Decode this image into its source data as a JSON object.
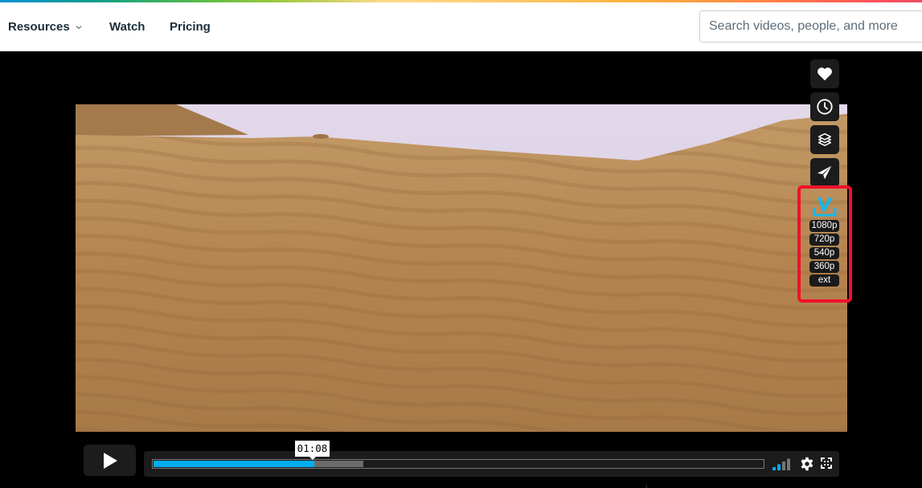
{
  "nav": {
    "items": [
      {
        "label": "Resources",
        "has_dropdown": true
      },
      {
        "label": "Watch"
      },
      {
        "label": "Pricing"
      }
    ],
    "search_placeholder": "Search videos, people, and more"
  },
  "player": {
    "side_actions": [
      {
        "name": "like",
        "icon": "heart-icon"
      },
      {
        "name": "watch-later",
        "icon": "clock-icon"
      },
      {
        "name": "collections",
        "icon": "layers-icon"
      },
      {
        "name": "share",
        "icon": "paper-plane-icon"
      }
    ],
    "download": {
      "icon": "vimeo-download-icon",
      "icon_color": "#1ab7ea",
      "highlight_color": "#f0102a",
      "resolutions": [
        "1080p",
        "720p",
        "540p",
        "360p",
        "ext"
      ]
    },
    "controls": {
      "play_icon": "play-icon",
      "time_tooltip": "01:08",
      "played_fraction": 0.263,
      "loaded_fraction": 0.344,
      "volume_level": 0.5,
      "accent_color": "#00adef"
    }
  }
}
